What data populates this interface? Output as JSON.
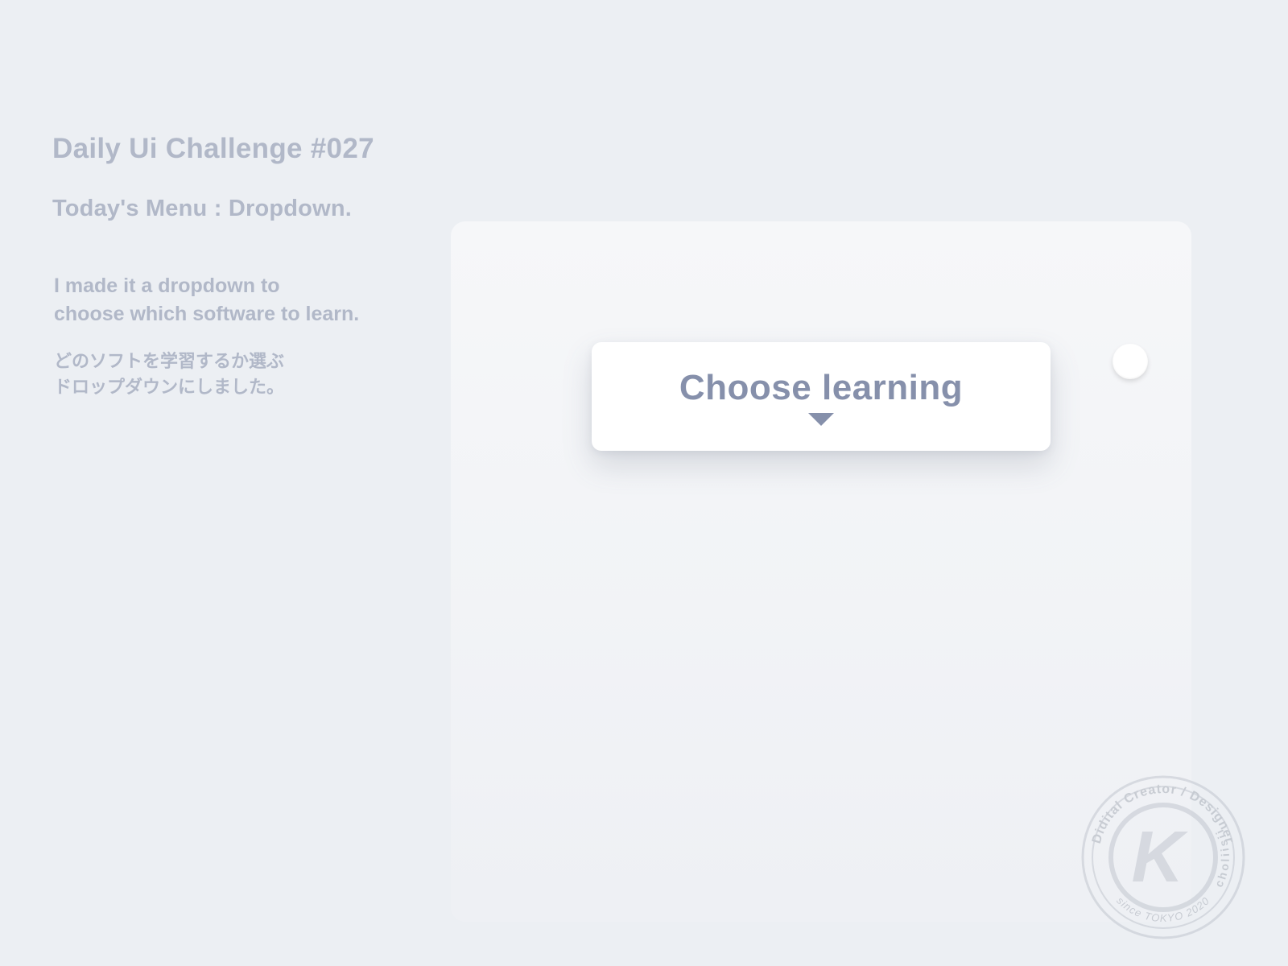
{
  "header": {
    "title": "Daily Ui Challenge #027",
    "subtitle": "Today's Menu : Dropdown."
  },
  "description": {
    "en_line1": "I made it a dropdown to",
    "en_line2": "choose which software to learn.",
    "jp_line1": "どのソフトを学習するか選ぶ",
    "jp_line2": "ドロップダウンにしました。"
  },
  "dropdown": {
    "label": "Choose learning",
    "icon": "chevron-down"
  },
  "stamp": {
    "top_text": "Didital Creator / Designer",
    "side_text": "choliisii",
    "bottom_text": "since TOKYO 2020",
    "monogram": "K"
  }
}
